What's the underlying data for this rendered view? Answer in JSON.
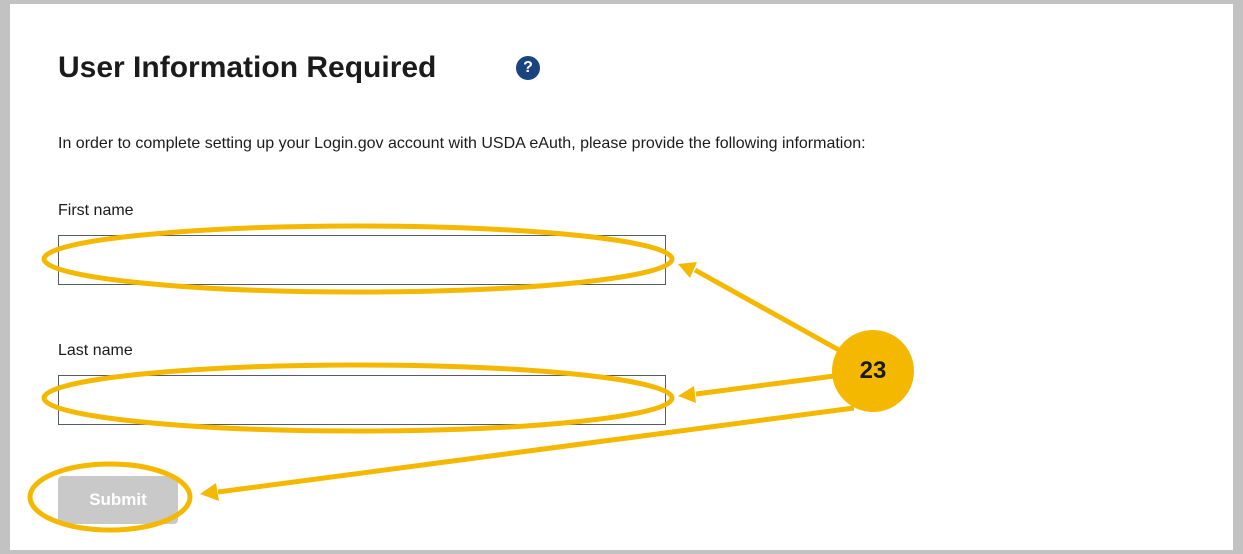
{
  "form": {
    "title": "User Information Required",
    "help_icon_glyph": "?",
    "intro": "In order to complete setting up your Login.gov account with USDA eAuth, please provide the following information:",
    "first_name_label": "First name",
    "first_name_value": "",
    "last_name_label": "Last name",
    "last_name_value": "",
    "submit_label": "Submit"
  },
  "callout": {
    "number": "23",
    "color": "#f5b800"
  },
  "icons": {
    "help": "question-circle-icon"
  },
  "colors": {
    "help_icon": "#1a4480",
    "submit_disabled": "#c9c9c9",
    "border": "#c2c2c2"
  }
}
